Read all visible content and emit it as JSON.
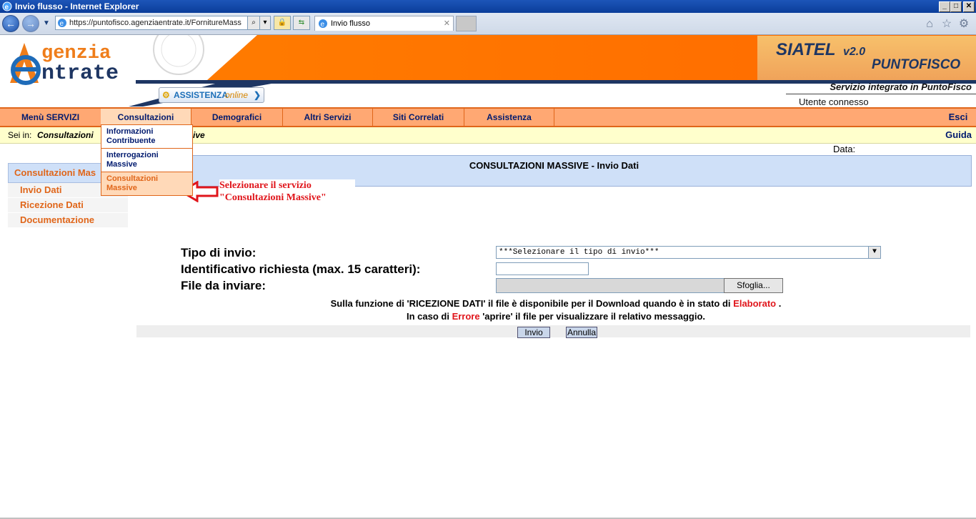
{
  "browser": {
    "window_title": "Invio flusso - Internet Explorer",
    "url": "https://puntofisco.agenziaentrate.it/FornitureMass",
    "tab_title": "Invio flusso"
  },
  "header": {
    "logo_line1": "genzia",
    "logo_line2": "ntrate",
    "assistenza_label": "ASSISTENZA",
    "assistenza_sub": "online",
    "siatel_title": "SIATEL",
    "siatel_version": "v2.0",
    "siatel_sub": "PUNTOFISCO",
    "service_text": "Servizio integrato in PuntoFisco",
    "utente_label": "Utente connesso"
  },
  "menu": {
    "items": [
      "Menù SERVIZI",
      "Consultazioni",
      "Demografici",
      "Altri Servizi",
      "Siti Correlati",
      "Assistenza"
    ],
    "esci": "Esci"
  },
  "breadcrumb": {
    "prefix": "Sei in:",
    "path": "Consultazioni",
    "tail": "ive",
    "guida": "Guida"
  },
  "data_label": "Data:",
  "dropdown": {
    "items": [
      "Informazioni Contribuente",
      "Interrogazioni Massive",
      "Consultazioni Massive"
    ]
  },
  "leftnav": {
    "header": "Consultazioni Mas",
    "items": [
      "Invio Dati",
      "Ricezione Dati",
      "Documentazione"
    ]
  },
  "annotation": {
    "line1": "Selezionare il servizio",
    "line2": "\"Consultazioni Massive\""
  },
  "panel_title": "CONSULTAZIONI MASSIVE - Invio Dati",
  "form": {
    "tipo_label": "Tipo di invio:",
    "tipo_value": "***Selezionare il tipo di invio***",
    "id_label": "Identificativo richiesta (max. 15 caratteri):",
    "id_value": "",
    "file_label": "File da inviare:",
    "sfoglia": "Sfoglia...",
    "info1_a": "Sulla funzione di 'RICEZIONE DATI' il file è disponibile per il Download quando è in stato di",
    "info1_b": "Elaborato",
    "info1_c": ".",
    "info2_a": "In caso di",
    "info2_b": "Errore",
    "info2_c": "'aprire' il file per visualizzare il relativo messaggio.",
    "invio": "Invio",
    "annulla": "Annulla"
  },
  "colors": {
    "accent_orange": "#ff7a00",
    "menu_bg": "#ffa873",
    "link_orange": "#e0661a",
    "navy": "#001a6e",
    "panel_blue": "#cfe0f8",
    "error_red": "#e0151b"
  }
}
